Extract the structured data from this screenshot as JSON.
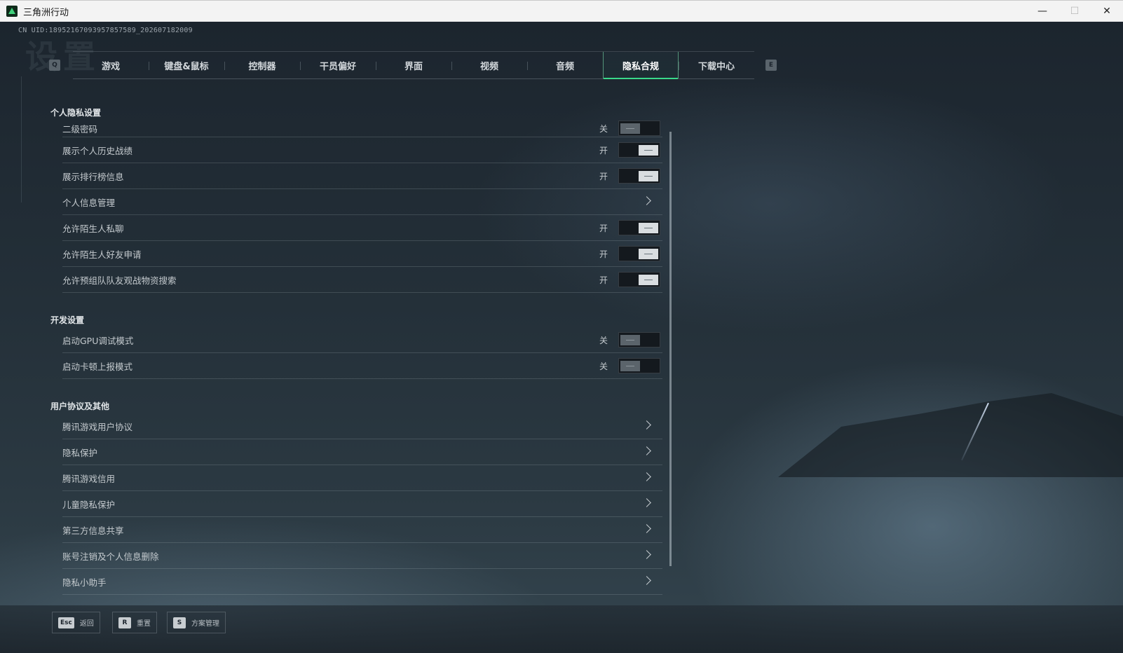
{
  "window": {
    "title": "三角洲行动",
    "minimize": "—",
    "maximize": "☐",
    "close": "✕"
  },
  "uid": "CN UID:1895216709395785758​9_202607182009",
  "bg_title": "设置",
  "tabs": {
    "left_key": "Q",
    "right_key": "E",
    "items": [
      "游戏",
      "键盘&鼠标",
      "控制器",
      "干员偏好",
      "界面",
      "视频",
      "音频",
      "隐私合规",
      "下载中心"
    ],
    "active": "隐私合规"
  },
  "sections": {
    "privacy": {
      "title": "个人隐私设置",
      "rows": [
        {
          "label": "二级密码",
          "state": "关",
          "type": "toggle",
          "on": false
        },
        {
          "label": "展示个人历史战绩",
          "state": "开",
          "type": "toggle",
          "on": true
        },
        {
          "label": "展示排行榜信息",
          "state": "开",
          "type": "toggle",
          "on": true
        },
        {
          "label": "个人信息管理",
          "type": "link"
        },
        {
          "label": "允许陌生人私聊",
          "state": "开",
          "type": "toggle",
          "on": true
        },
        {
          "label": "允许陌生人好友申请",
          "state": "开",
          "type": "toggle",
          "on": true
        },
        {
          "label": "允许预组队队友观战物资搜索",
          "state": "开",
          "type": "toggle",
          "on": true
        }
      ]
    },
    "dev": {
      "title": "开发设置",
      "rows": [
        {
          "label": "启动GPU调试模式",
          "state": "关",
          "type": "toggle",
          "on": false
        },
        {
          "label": "启动卡顿上报模式",
          "state": "关",
          "type": "toggle",
          "on": false
        }
      ]
    },
    "agreements": {
      "title": "用户协议及其他",
      "rows": [
        {
          "label": "腾讯游戏用户协议",
          "type": "link"
        },
        {
          "label": "隐私保护",
          "type": "link"
        },
        {
          "label": "腾讯游戏信用",
          "type": "link"
        },
        {
          "label": "儿童隐私保护",
          "type": "link"
        },
        {
          "label": "第三方信息共享",
          "type": "link"
        },
        {
          "label": "账号注销及个人信息删除",
          "type": "link"
        },
        {
          "label": "隐私小助手",
          "type": "link"
        }
      ]
    }
  },
  "bottom": {
    "back": {
      "key": "Esc",
      "label": "返回"
    },
    "reset": {
      "key": "R",
      "label": "重置"
    },
    "scheme": {
      "key": "S",
      "label": "方案管理"
    }
  },
  "colors": {
    "accent": "#39d98a",
    "toggle_on": "#d9dde0",
    "toggle_off": "#5b646b"
  }
}
